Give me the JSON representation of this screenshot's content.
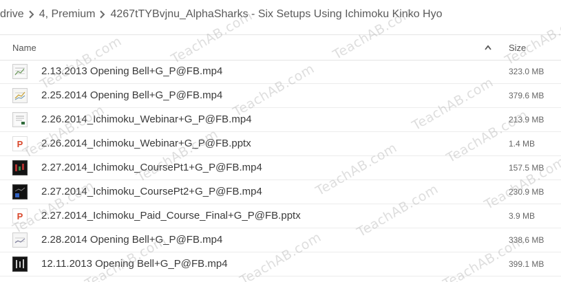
{
  "breadcrumb": {
    "items": [
      {
        "label": "drive"
      },
      {
        "label": "4, Premium"
      },
      {
        "label": "4267tTYBvjnu_AlphaSharks - Six Setups Using Ichimoku Kinko Hyo"
      }
    ]
  },
  "table": {
    "header": {
      "name_label": "Name",
      "size_label": "Size",
      "sort_direction": "ascending"
    },
    "rows": [
      {
        "name": "2.13.2013 Opening Bell+G_P@FB.mp4",
        "size": "323.0 MB",
        "icon": "video-thumbnail-chart-icon"
      },
      {
        "name": "2.25.2014 Opening Bell+G_P@FB.mp4",
        "size": "379.6 MB",
        "icon": "video-thumbnail-chart-icon"
      },
      {
        "name": "2.26.2014_Ichimoku_Webinar+G_P@FB.mp4",
        "size": "213.9 MB",
        "icon": "video-thumbnail-chart-icon"
      },
      {
        "name": "2.26.2014_Ichimoku_Webinar+G_P@FB.pptx",
        "size": "1.4 MB",
        "icon": "powerpoint-icon"
      },
      {
        "name": "2.27.2014_Ichimoku_CoursePt1+G_P@FB.mp4",
        "size": "157.5 MB",
        "icon": "video-thumbnail-dark-icon"
      },
      {
        "name": "2.27.2014_Ichimoku_CoursePt2+G_P@FB.mp4",
        "size": "230.9 MB",
        "icon": "video-thumbnail-dark-icon"
      },
      {
        "name": "2.27.2014_Ichimoku_Paid_Course_Final+G_P@FB.pptx",
        "size": "3.9 MB",
        "icon": "powerpoint-icon"
      },
      {
        "name": "2.28.2014 Opening Bell+G_P@FB.mp4",
        "size": "338.6 MB",
        "icon": "video-thumbnail-chart-icon"
      },
      {
        "name": "12.11.2013 Opening Bell+G_P@FB.mp4",
        "size": "399.1 MB",
        "icon": "video-thumbnail-dark-icon"
      }
    ]
  },
  "watermark": {
    "text": "TeachAB.com"
  },
  "colors": {
    "ppt_icon": "#d9472b",
    "row_border": "#ececec",
    "text": "#3a3a3a"
  }
}
